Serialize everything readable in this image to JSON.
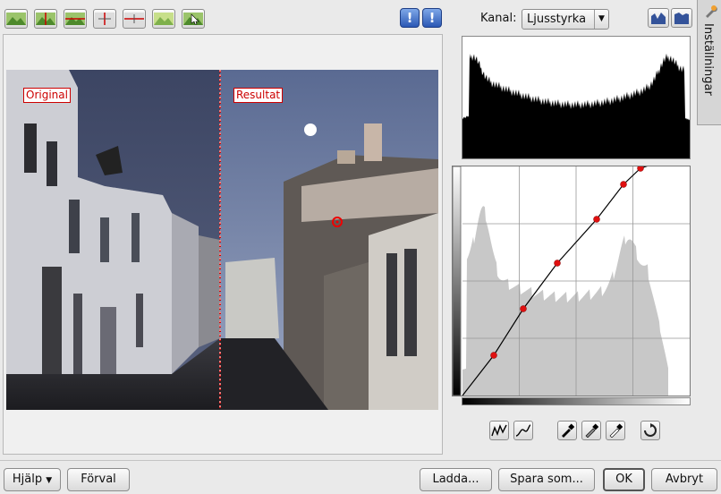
{
  "toolbar": {
    "buttons": [
      {
        "name": "preview-original-icon"
      },
      {
        "name": "split-vertical-icon"
      },
      {
        "name": "split-horizontal-icon"
      },
      {
        "name": "split-vertical-dual-icon"
      },
      {
        "name": "split-horizontal-dual-icon"
      },
      {
        "name": "preview-result-icon"
      },
      {
        "name": "pick-color-icon"
      }
    ],
    "info_symbol_1": "!",
    "info_symbol_2": "!"
  },
  "preview": {
    "label_original": "Original",
    "label_result": "Resultat"
  },
  "channel": {
    "label": "Kanal:",
    "value": "Ljusstyrka"
  },
  "side_tab": {
    "label": "Inställningar"
  },
  "curve": {
    "points": [
      [
        0,
        0
      ],
      [
        35,
        45
      ],
      [
        68,
        97
      ],
      [
        106,
        148
      ],
      [
        150,
        197
      ],
      [
        180,
        236
      ],
      [
        199,
        254
      ],
      [
        235,
        266
      ],
      [
        254,
        270
      ]
    ]
  },
  "buttons": {
    "help": "Hjälp",
    "defaults": "Förval",
    "load": "Ladda...",
    "save_as": "Spara som...",
    "ok": "OK",
    "cancel": "Avbryt"
  },
  "colors": {
    "accent_red": "#cc0000",
    "info_blue": "#2b58b4"
  }
}
